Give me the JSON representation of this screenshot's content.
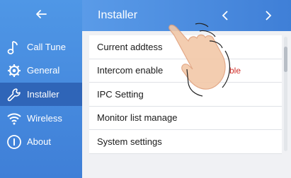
{
  "header": {
    "title": "Installer",
    "back_icon": "arrow-left-icon",
    "prev_icon": "chevron-left-icon",
    "next_icon": "chevron-right-icon"
  },
  "sidebar": {
    "items": [
      {
        "label": "Call Tune",
        "icon": "music-note-icon"
      },
      {
        "label": "General",
        "icon": "gear-icon"
      },
      {
        "label": "Installer",
        "icon": "wrench-icon",
        "active": true
      },
      {
        "label": "Wireless",
        "icon": "wifi-icon"
      },
      {
        "label": "About",
        "icon": "info-icon"
      }
    ]
  },
  "list": {
    "items": [
      {
        "label": "Current addtess"
      },
      {
        "label": "Intercom enable",
        "suffix": "ble"
      },
      {
        "label": "IPC Setting"
      },
      {
        "label": "Monitor list manage"
      },
      {
        "label": "System settings"
      }
    ]
  },
  "colors": {
    "sidebar": "#3f7fd7",
    "active_item": "#2f65b8",
    "suffix_text": "#d0302a"
  }
}
